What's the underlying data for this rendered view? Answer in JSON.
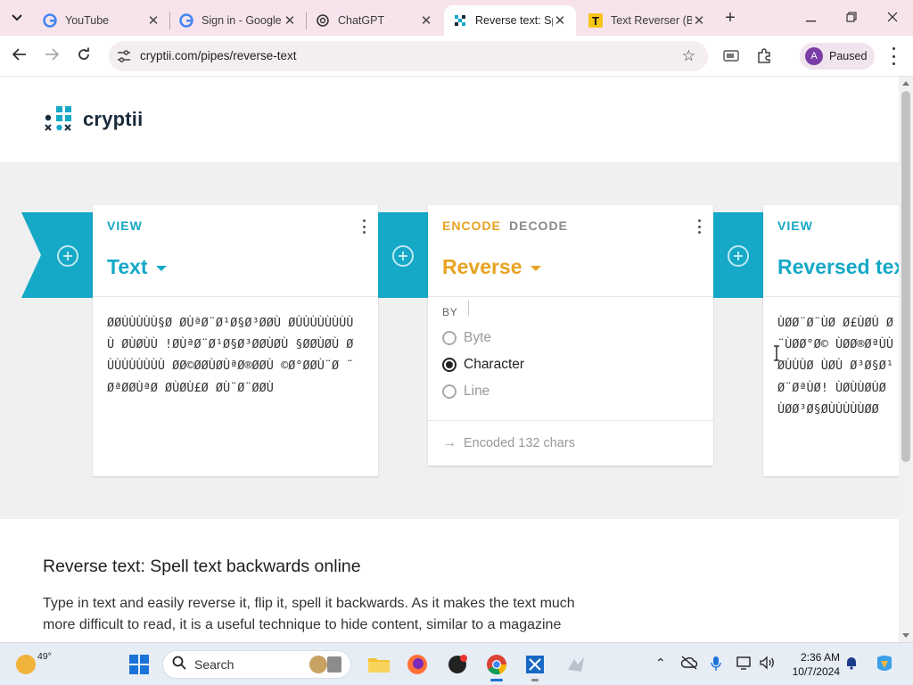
{
  "browser": {
    "tabs": [
      {
        "title": "YouTube",
        "icon": "google-g-icon",
        "active": false
      },
      {
        "title": "Sign in - Google",
        "icon": "google-g-icon",
        "active": false
      },
      {
        "title": "ChatGPT",
        "icon": "chatgpt-icon",
        "active": false
      },
      {
        "title": "Reverse text: Spell",
        "icon": "cryptii-icon",
        "active": true
      },
      {
        "title": "Text Reverser (Bac",
        "icon": "t-letter-icon",
        "active": false
      }
    ],
    "url": "cryptii.com/pipes/reverse-text",
    "profile": {
      "initial": "A",
      "status": "Paused"
    }
  },
  "site": {
    "logo_text": "cryptii"
  },
  "bricks": {
    "input": {
      "kind": "VIEW",
      "name": "Text",
      "content": "ØØÙÙÙÙÙ§Ø ØÙªØ¨Ø¹Ø§Ø³ØØÙ ØÙÙÙÙÙÙÙÙÙ ØÙØÙÙ !ØÙªØ¨Ø¹Ø§Ø³ØØÙØÙ §ØØÙØÙ ØÙÙÙÙÙÙÙÙ ØØ©ØØÙØÙªØ®ØØÙ ©Ø°ØØÙ¨Ø ¨ØªØØÙªØ ØÙØÙ£Ø ØÙ¨Ø¨ØØÙ"
    },
    "encoder": {
      "tab_encode": "ENCODE",
      "tab_decode": "DECODE",
      "name": "Reverse",
      "by_label": "BY",
      "options": [
        {
          "label": "Byte",
          "selected": false
        },
        {
          "label": "Character",
          "selected": true
        },
        {
          "label": "Line",
          "selected": false
        }
      ],
      "status": "Encoded 132 chars"
    },
    "output": {
      "kind": "VIEW",
      "name": "Reversed text",
      "content": "ÙØØ¨Ø¨ÙØ Ø£ÙØÙ Ø¨ÙØØ°Ø© ÙØØ®ØªÙÙØÙÙÙØ ÙØÙ Ø³Ø§Ø¹Ø¨ØªÙØ! ÙØÙÙØÙØ ÙØØ³Ø§ØÙÙÙÙÙØØ"
    }
  },
  "article": {
    "heading": "Reverse text: Spell text backwards online",
    "body": "Type in text and easily reverse it, flip it, spell it backwards. As it makes the text much more difficult to read, it is a useful technique to hide content, similar to a magazine"
  },
  "taskbar": {
    "temperature": "49°",
    "search_label": "Search",
    "time": "2:36 AM",
    "date": "10/7/2024"
  },
  "colors": {
    "teal": "#15a8c7",
    "orange": "#e8a321",
    "tabstrip": "#f6e3ec"
  }
}
